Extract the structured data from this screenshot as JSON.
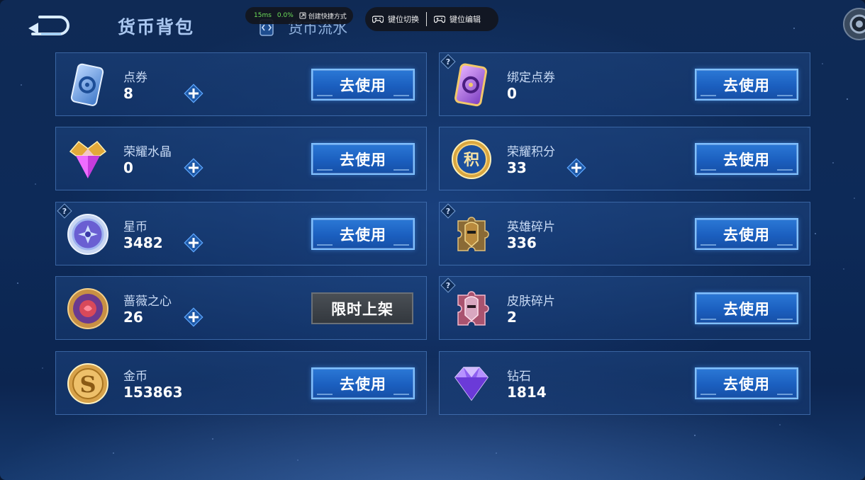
{
  "header": {
    "title": "货币背包",
    "flow_tab": "货币流水"
  },
  "overlay": {
    "latency": "15ms",
    "loss": "0.0%",
    "shortcut_label": "创建快捷方式",
    "key_switch": "键位切换",
    "key_edit": "键位编辑"
  },
  "cards": [
    {
      "name": "点券",
      "amount": "8",
      "button": "去使用",
      "icon": "voucher-card-icon",
      "plus": true,
      "help": false
    },
    {
      "name": "绑定点券",
      "amount": "0",
      "button": "去使用",
      "icon": "bound-voucher-card-icon",
      "plus": false,
      "help": true
    },
    {
      "name": "荣耀水晶",
      "amount": "0",
      "button": "去使用",
      "icon": "glory-crystal-icon",
      "plus": true,
      "help": false
    },
    {
      "name": "荣耀积分",
      "amount": "33",
      "button": "去使用",
      "icon": "glory-points-icon",
      "plus": true,
      "help": false
    },
    {
      "name": "星币",
      "amount": "3482",
      "button": "去使用",
      "icon": "star-coin-icon",
      "plus": true,
      "help": true
    },
    {
      "name": "英雄碎片",
      "amount": "336",
      "button": "去使用",
      "icon": "hero-fragment-icon",
      "plus": false,
      "help": true
    },
    {
      "name": "蔷薇之心",
      "amount": "26",
      "button": "限时上架",
      "icon": "rose-heart-icon",
      "plus": true,
      "help": false
    },
    {
      "name": "皮肤碎片",
      "amount": "2",
      "button": "去使用",
      "icon": "skin-fragment-icon",
      "plus": false,
      "help": true
    },
    {
      "name": "金币",
      "amount": "153863",
      "button": "去使用",
      "icon": "gold-coin-icon",
      "plus": false,
      "help": false
    },
    {
      "name": "钻石",
      "amount": "1814",
      "button": "去使用",
      "icon": "diamond-icon",
      "plus": false,
      "help": false
    }
  ]
}
